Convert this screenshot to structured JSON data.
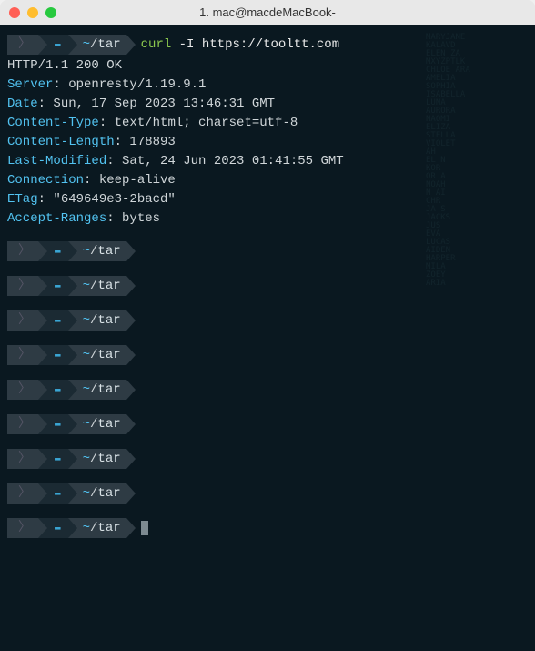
{
  "window": {
    "title": "1. mac@macdeMacBook-"
  },
  "prompt": {
    "apple_glyph": "",
    "folder_glyph": "📁",
    "path_tilde": "~",
    "path_sep": "/",
    "path_dir": "tar"
  },
  "command": {
    "cmd": "curl",
    "flag": "-I",
    "url": "https://tooltt.com"
  },
  "output": {
    "status": "HTTP/1.1 200 OK",
    "headers": [
      {
        "name": "Server",
        "value": "openresty/1.19.9.1"
      },
      {
        "name": "Date",
        "value": "Sun, 17 Sep 2023 13:46:31 GMT"
      },
      {
        "name": "Content-Type",
        "value": "text/html; charset=utf-8"
      },
      {
        "name": "Content-Length",
        "value": "178893"
      },
      {
        "name": "Last-Modified",
        "value": "Sat, 24 Jun 2023 01:41:55 GMT"
      },
      {
        "name": "Connection",
        "value": "keep-alive"
      },
      {
        "name": "ETag",
        "value": "\"649649e3-2bacd\""
      },
      {
        "name": "Accept-Ranges",
        "value": "bytes"
      }
    ]
  },
  "empty_prompt_count": 8,
  "show_cursor_on_last": true
}
